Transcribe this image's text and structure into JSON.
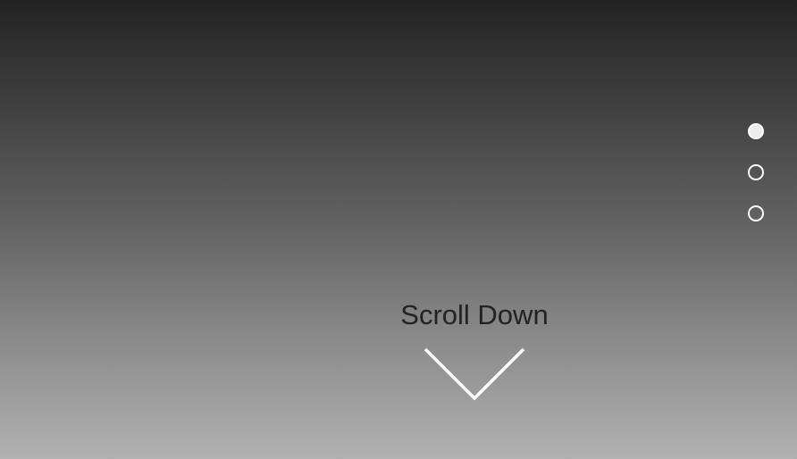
{
  "section_nav": {
    "items": [
      {
        "label": "section-1",
        "active": true
      },
      {
        "label": "section-2",
        "active": false
      },
      {
        "label": "section-3",
        "active": false
      }
    ],
    "color": "#ffffff",
    "active_fill": "#ececec"
  },
  "scroll_cue": {
    "label": "Scroll Down",
    "icon": "chevron-down-icon",
    "text_color": "#222222",
    "icon_color": "#ffffff"
  },
  "background": {
    "gradient_top": "#232323",
    "gradient_bottom": "#b1b1b1"
  }
}
